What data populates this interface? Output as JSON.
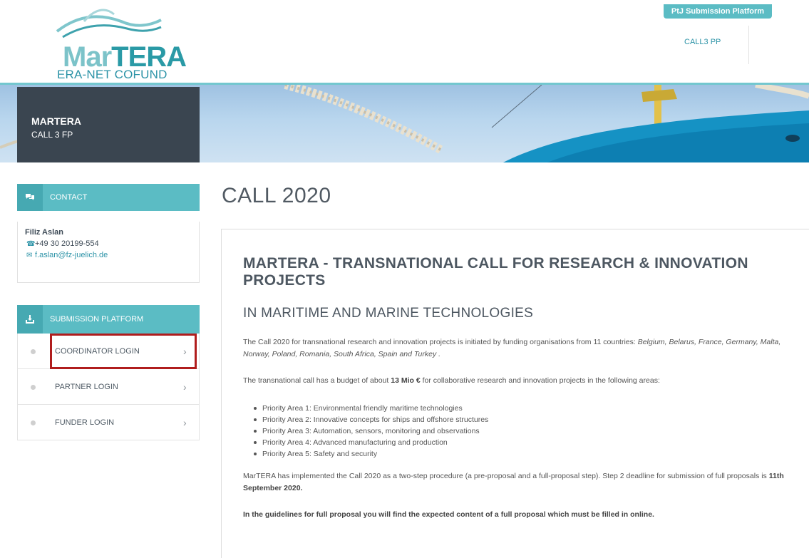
{
  "header": {
    "logo": {
      "word_left": "Mar",
      "word_right": "TERA",
      "subtitle": "ERA-NET COFUND"
    },
    "ptj_tab": "PtJ Submission Platform",
    "nav": {
      "call3pp": "CALL3 PP"
    }
  },
  "banner": {
    "title": "MARTERA",
    "subtitle": "CALL 3 FP"
  },
  "sidebar": {
    "contact": {
      "heading": "CONTACT",
      "name": "Filiz Aslan",
      "phone": "+49 30 20199-554",
      "email": "f.aslan@fz-juelich.de"
    },
    "submission": {
      "heading": "SUBMISSION PLATFORM",
      "items": [
        {
          "label": "COORDINATOR LOGIN"
        },
        {
          "label": "PARTNER LOGIN"
        },
        {
          "label": "FUNDER LOGIN"
        }
      ]
    }
  },
  "main": {
    "page_title": "CALL 2020",
    "heading": "MARTERA - TRANSNATIONAL CALL FOR RESEARCH & INNOVATION PROJECTS",
    "subheading": "IN MARITIME AND MARINE TECHNOLOGIES",
    "para1_text": "The Call 2020 for transnational research and innovation projects is initiated by funding organisations from 11 countries: ",
    "para1_countries": "Belgium, Belarus, France, Germany, Malta, Norway, Poland, Romania, South Africa, Spain and Turkey",
    "para1_end": " .",
    "para2_pre": "The transnational call has a budget of about ",
    "para2_bold": "13 Mio €",
    "para2_post": " for collaborative research and innovation projects in the following areas:",
    "areas": [
      "Priority Area 1: Environmental friendly maritime technologies",
      "Priority Area 2: Innovative concepts for ships and offshore structures",
      "Priority Area 3: Automation, sensors, monitoring and observations",
      "Priority Area 4: Advanced manufacturing and production",
      "Priority Area 5: Safety and security"
    ],
    "para3_pre": "MarTERA has implemented the Call 2020 as a two-step procedure (a pre-proposal and a full-proposal step). Step 2 deadline for submission of full proposals is ",
    "para3_bold": "11th September 2020.",
    "para4": "In the guidelines for full proposal you will find the expected content of a full proposal which must be filled in online."
  },
  "colors": {
    "accent": "#5bbcc4",
    "dark_panel": "#3a4550",
    "highlight": "#b01d1d"
  }
}
